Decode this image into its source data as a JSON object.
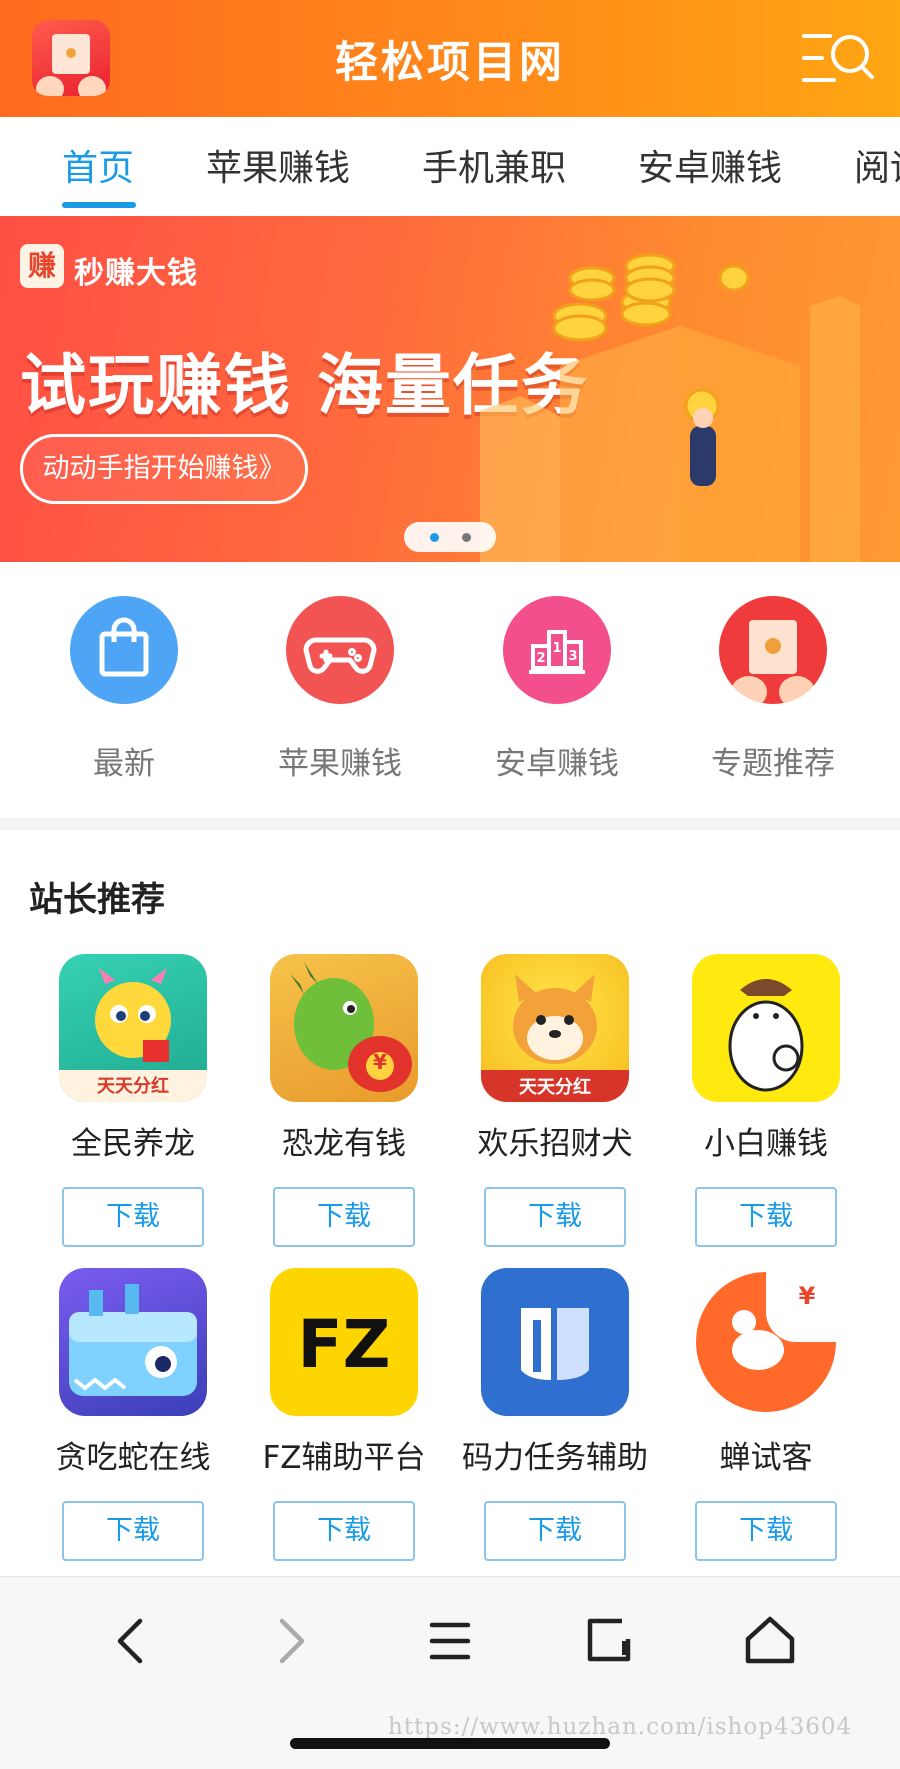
{
  "header": {
    "title": "轻松项目网"
  },
  "tabs": [
    {
      "label": "首页",
      "active": true
    },
    {
      "label": "苹果赚钱"
    },
    {
      "label": "手机兼职"
    },
    {
      "label": "安卓赚钱"
    },
    {
      "label": "阅读"
    }
  ],
  "banner": {
    "brand": "秒赚大钱",
    "logo_char": "赚",
    "headline": "试玩赚钱 海量任务",
    "cta": "动动手指开始赚钱》",
    "active_slide": 1,
    "slide_count": 2
  },
  "categories": [
    {
      "label": "最新",
      "icon": "shopping-bag-icon",
      "color": "#4ea5f5"
    },
    {
      "label": "苹果赚钱",
      "icon": "gamepad-icon",
      "color": "#f25454"
    },
    {
      "label": "安卓赚钱",
      "icon": "podium-icon",
      "color": "#f34f8d"
    },
    {
      "label": "专题推荐",
      "icon": "red-envelope-icon",
      "color": "#ef3b3b"
    }
  ],
  "recommend": {
    "title": "站长推荐",
    "download_label": "下载",
    "apps": [
      {
        "name": "全民养龙",
        "icon_text": "天天分红"
      },
      {
        "name": "恐龙有钱",
        "icon_text": "¥"
      },
      {
        "name": "欢乐招财犬",
        "icon_text": "天天分红"
      },
      {
        "name": "小白赚钱",
        "icon_text": ""
      },
      {
        "name": "贪吃蛇在线",
        "icon_text": ""
      },
      {
        "name": "FZ辅助平台",
        "icon_text": "FZ"
      },
      {
        "name": "码力任务辅助",
        "icon_text": ""
      },
      {
        "name": "蝉试客",
        "icon_text": "¥"
      }
    ]
  },
  "bottom_nav": [
    "back-icon",
    "forward-icon",
    "menu-icon",
    "tabs-icon",
    "home-icon"
  ],
  "watermark": "https://www.huzhan.com/ishop43604",
  "colors": {
    "accent": "#1a9be8",
    "header_start": "#ff6a1f",
    "header_end": "#ffa613"
  }
}
